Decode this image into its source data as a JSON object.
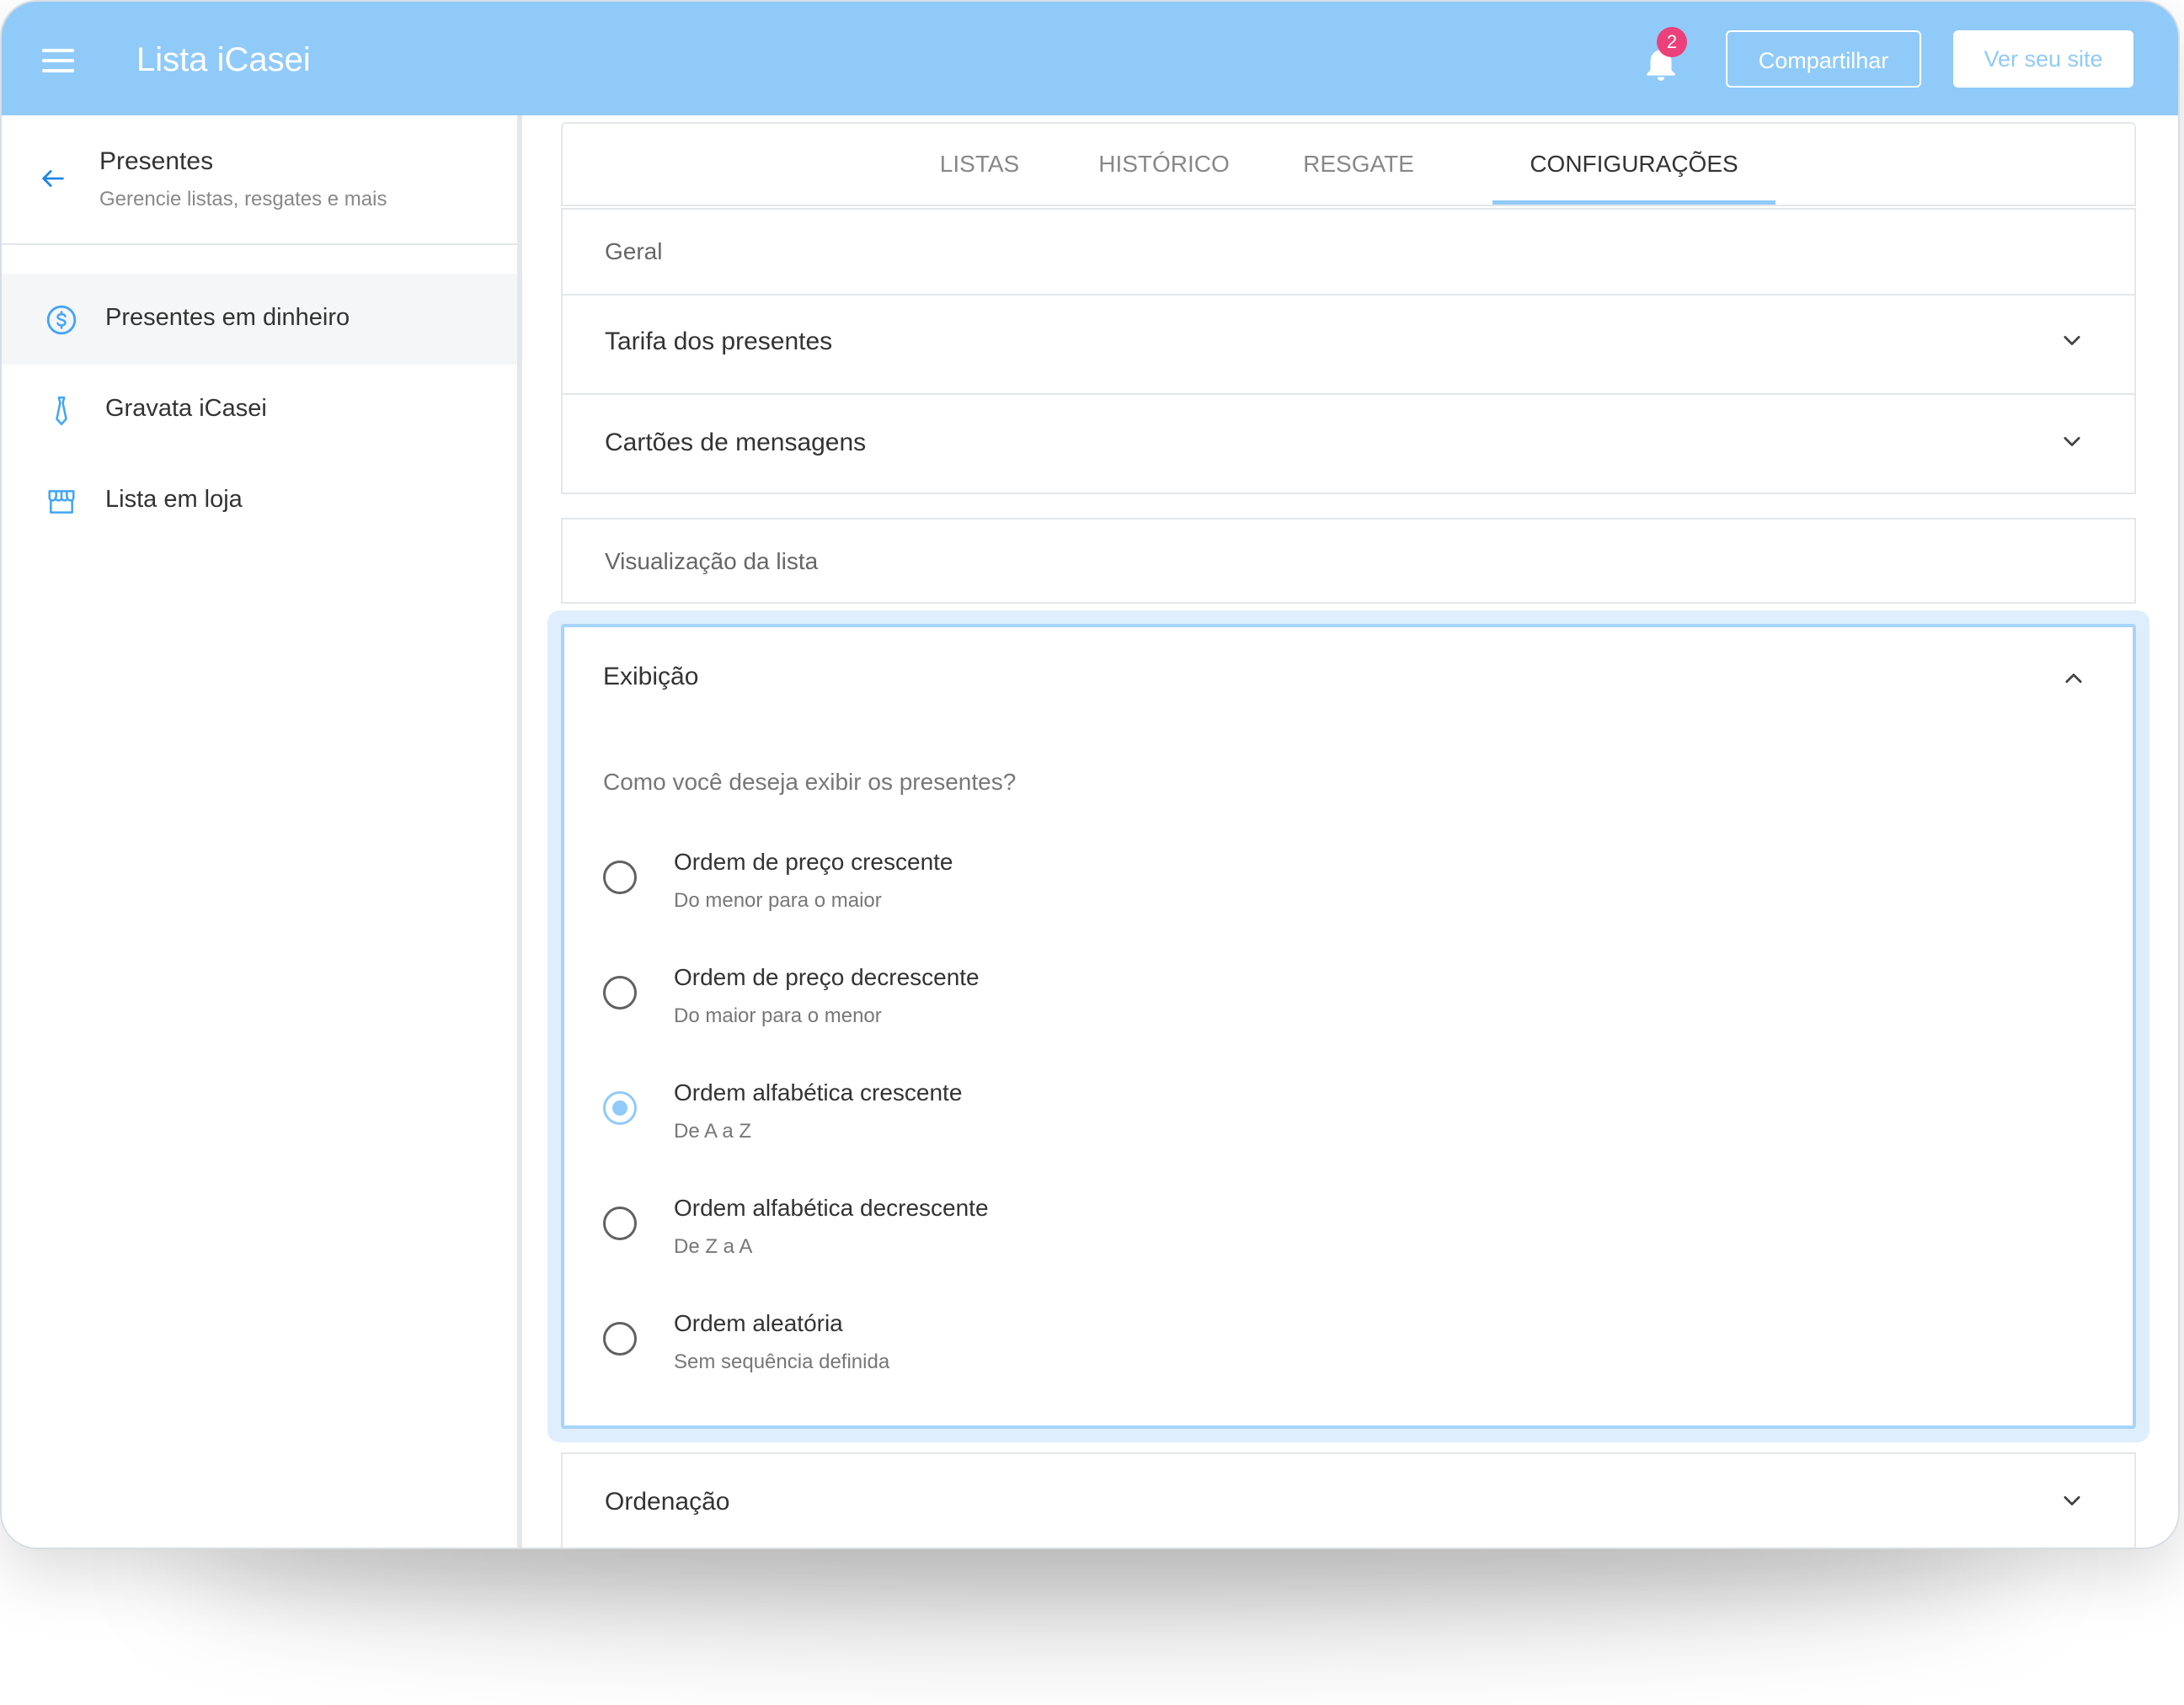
{
  "header": {
    "app_title": "Lista iCasei",
    "notification_count": "2",
    "share_label": "Compartilhar",
    "site_label": "Ver seu site",
    "color": "#90caf9"
  },
  "sidebar": {
    "title": "Presentes",
    "subtitle": "Gerencie listas, resgates e mais",
    "items": [
      {
        "label": "Presentes em dinheiro",
        "icon": "dollar-circle-icon",
        "active": true
      },
      {
        "label": "Gravata iCasei",
        "icon": "tie-icon",
        "active": false
      },
      {
        "label": "Lista em loja",
        "icon": "store-icon",
        "active": false
      }
    ]
  },
  "tabs": [
    {
      "label": "LISTAS",
      "active": false
    },
    {
      "label": "HISTÓRICO",
      "active": false
    },
    {
      "label": "RESGATE",
      "active": false
    },
    {
      "label": "CONFIGURAÇÕES",
      "active": true
    }
  ],
  "sections": {
    "geral": {
      "label": "Geral",
      "rows": [
        "Tarifa dos presentes",
        "Cartões de mensagens"
      ]
    },
    "visualizacao": {
      "label": "Visualização da lista"
    },
    "exibicao": {
      "title": "Exibição",
      "question": "Como você deseja exibir os presentes?",
      "selected_index": 2,
      "options": [
        {
          "title": "Ordem de preço crescente",
          "subtitle": "Do menor para o maior"
        },
        {
          "title": "Ordem de preço decrescente",
          "subtitle": "Do maior para o menor"
        },
        {
          "title": "Ordem alfabética crescente",
          "subtitle": "De A a Z"
        },
        {
          "title": "Ordem alfabética decrescente",
          "subtitle": "De Z a A"
        },
        {
          "title": "Ordem aleatória",
          "subtitle": "Sem sequência definida"
        }
      ]
    },
    "ordenacao": {
      "title": "Ordenação"
    }
  }
}
